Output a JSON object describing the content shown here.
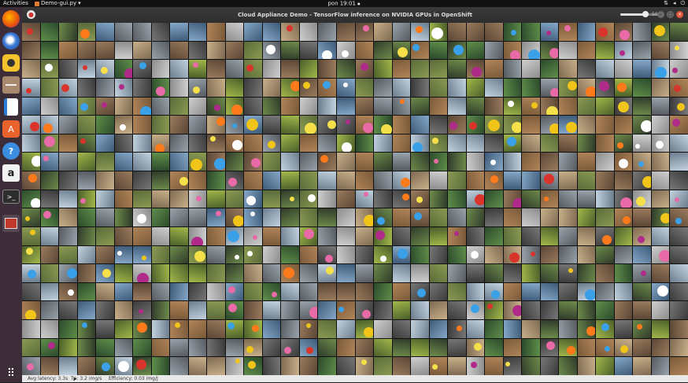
{
  "topbar": {
    "activities": "Activities",
    "app_menu": "Demo-gui.py",
    "app_menu_arrow": "▾",
    "clock": "pon 19:01",
    "clock_dot": "●",
    "tray_icons": [
      "network-icon",
      "volume-icon",
      "power-icon"
    ]
  },
  "dock": {
    "items": [
      "firefox-icon",
      "thunderbird-icon",
      "rhythmbox-icon",
      "files-icon",
      "libreoffice-writer-icon",
      "software-center-icon",
      "help-icon",
      "amazon-icon",
      "terminal-icon",
      "demo-app-icon"
    ],
    "show_apps": "apps-grid-icon"
  },
  "window": {
    "title": "Cloud Appliance Demo - TensorFlow inference on NVIDIA GPUs in OpenShift",
    "slider_value": "50",
    "slider_fraction": 0.62,
    "controls": [
      "minimize-icon",
      "maximize-icon",
      "close-icon"
    ],
    "grid_description": "grid of classified thumbnail images"
  },
  "status": {
    "avg_latency": "Avg latency: 3.3s",
    "throughput": "Tp: 3.2 img/s",
    "efficiency": "Efficiency: 0.03 img/J"
  },
  "colors": {
    "dock_bg": "#3c2d39",
    "topbar_bg": "#121212",
    "close_button": "#e0573a"
  }
}
